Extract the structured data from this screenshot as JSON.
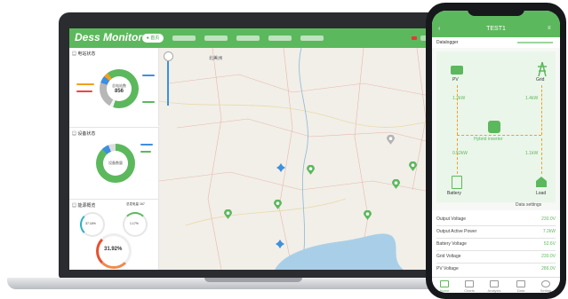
{
  "app": {
    "brand": "Dess Monitor",
    "active_tab": "● 首页"
  },
  "panels": {
    "panel1": {
      "title": "▤ 电站状态",
      "donut_label": "总电站数",
      "donut_value": "856"
    },
    "panel2": {
      "title": "▤ 设备状态",
      "donut_label": "设备数量"
    },
    "panel3": {
      "title": "▤ 能源概览",
      "right_label": "总发电量 167",
      "gauge1_value": "37.16%",
      "gauge2_value": "1.17%",
      "gauge3_value": "31.92%"
    }
  },
  "map": {
    "label": "北美洲"
  },
  "phone": {
    "title": "TEST1",
    "datalogger_label": "Datalogger",
    "nodes": {
      "pv": "PV",
      "grid": "Grid",
      "hybrid": "Hybrid inverter",
      "battery": "Battery",
      "load": "Load"
    },
    "flow_values": {
      "pv": "1.2kW",
      "grid": "1.4kW",
      "battery": "0.52kW",
      "load": "1.1kW"
    },
    "data_settings": "Data settings",
    "rows": [
      {
        "label": "Output Voltage",
        "value": "230.0V"
      },
      {
        "label": "Output Active Power",
        "value": "7.2kW"
      },
      {
        "label": "Battery Voltage",
        "value": "52.6V"
      },
      {
        "label": "Grid Voltage",
        "value": "230.0V"
      },
      {
        "label": "PV Voltage",
        "value": "286.0V"
      }
    ],
    "nav": [
      "Home",
      "Charts",
      "Analysis",
      "Data",
      "Setting"
    ]
  },
  "colors": {
    "brand_green": "#5cb85c",
    "map_water": "#a9cfe8"
  }
}
